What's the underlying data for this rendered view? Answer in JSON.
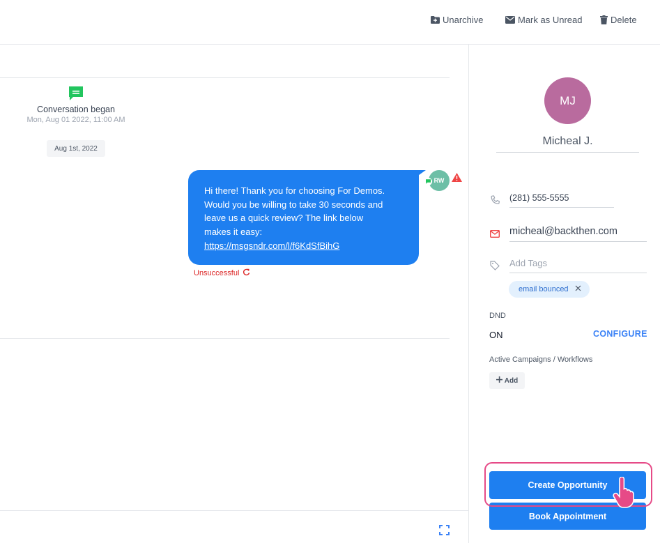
{
  "toolbar": {
    "unarchive_label": "Unarchive",
    "mark_unread_label": "Mark as Unread",
    "delete_label": "Delete"
  },
  "conversation": {
    "began_title": "Conversation began",
    "began_time": "Mon, Aug 01 2022, 11:00 AM",
    "date_pill": "Aug 1st, 2022",
    "message": {
      "lines": [
        "Hi there! Thank you for choosing For Demos.",
        "Would you be willing to take 30 seconds and",
        "leave us a quick review? The link below",
        "makes it easy:"
      ],
      "link": "https://msgsndr.com/l/f6KdSfBihG",
      "sender_initials": "RW",
      "status": "Unsuccessful"
    }
  },
  "contact": {
    "initials": "MJ",
    "name": "Micheal J.",
    "phone": "(281) 555-5555",
    "email": "micheal@backthen.com",
    "tags_placeholder": "Add Tags",
    "tags": [
      "email bounced"
    ],
    "dnd_label": "DND",
    "dnd_value": "ON",
    "configure_label": "CONFIGURE",
    "campaigns_label": "Active Campaigns / Workflows",
    "add_label": "Add"
  },
  "actions": {
    "create_opportunity": "Create Opportunity",
    "book_appointment": "Book Appointment"
  },
  "colors": {
    "accent": "#1e7ff0",
    "avatar_contact": "#b96b9e",
    "avatar_sender": "#6dbfa6",
    "error": "#dc2626",
    "highlight": "#e64a87",
    "conversation_icon": "#22c55e"
  },
  "icons": {
    "unarchive": "folder-plus-icon",
    "mark_unread": "envelope-icon",
    "delete": "trash-icon",
    "conversation": "chat-bubble-icon",
    "warning": "warning-triangle-icon",
    "retry": "refresh-icon",
    "phone": "phone-icon",
    "email": "mail-icon",
    "tag": "tag-icon",
    "expand": "fullscreen-icon",
    "cursor": "hand-pointer-icon"
  }
}
